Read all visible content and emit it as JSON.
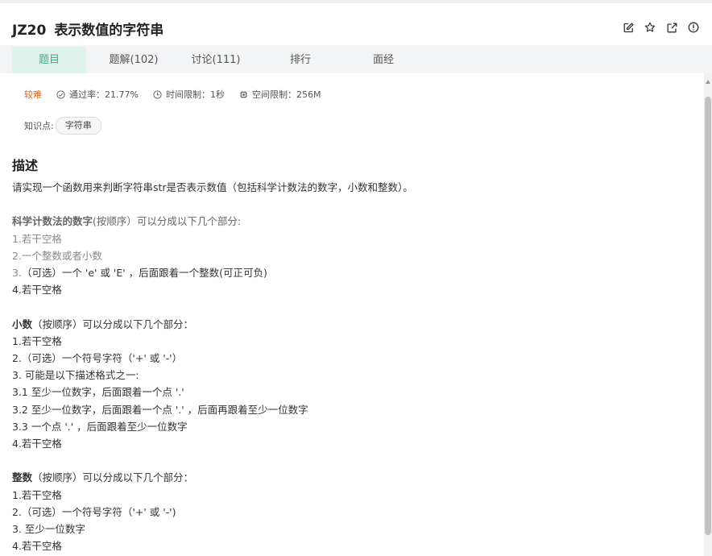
{
  "problem": {
    "id": "JZ20",
    "title": "表示数值的字符串"
  },
  "header_icons": [
    "edit-icon",
    "star-icon",
    "external-link-icon",
    "alert-icon"
  ],
  "tabs": [
    {
      "label": "题目",
      "active": true
    },
    {
      "label": "题解(102)",
      "active": false
    },
    {
      "label": "讨论(111)",
      "active": false
    },
    {
      "label": "排行",
      "active": false
    },
    {
      "label": "面经",
      "active": false
    }
  ],
  "meta": {
    "difficulty": "较难",
    "pass_rate": "通过率：21.77%",
    "time_limit": "时间限制：1秒",
    "memory_limit": "空间限制：256M"
  },
  "knowledge": {
    "label": "知识点:",
    "tag": "字符串"
  },
  "description": {
    "heading": "描述",
    "intro": "请实现一个函数用来判断字符串str是否表示数值（包括科学计数法的数字，小数和整数）。",
    "sci_head_bold": "科学计数法的数字",
    "sci_head_rest": "(按顺序）可以分成以下几个部分:",
    "sci_items": [
      "1.若干空格",
      "2.一个整数或者小数",
      "3.（可选）一个 'e' 或 'E' ，后面跟着一个整数(可正可负)",
      "4.若干空格"
    ],
    "dec_head_bold": "小数",
    "dec_head_rest": "（按顺序）可以分成以下几个部分：",
    "dec_items": [
      "1.若干空格",
      "2.（可选）一个符号字符（'+' 或 '-'）",
      "3. 可能是以下描述格式之一:",
      "3.1 至少一位数字，后面跟着一个点 '.'",
      "3.2 至少一位数字，后面跟着一个点 '.' ，后面再跟着至少一位数字",
      "3.3 一个点 '.' ，后面跟着至少一位数字",
      "4.若干空格"
    ],
    "int_head_bold": "整数",
    "int_head_rest": "（按顺序）可以分成以下几个部分：",
    "int_items": [
      "1.若干空格",
      "2.（可选）一个符号字符（'+' 或 '-')",
      "3. 至少一位数字",
      "4.若干空格"
    ]
  },
  "colors": {
    "accent": "#32b38a",
    "active_tab_bg": "#dff3ec",
    "difficulty": "#e2621b"
  }
}
